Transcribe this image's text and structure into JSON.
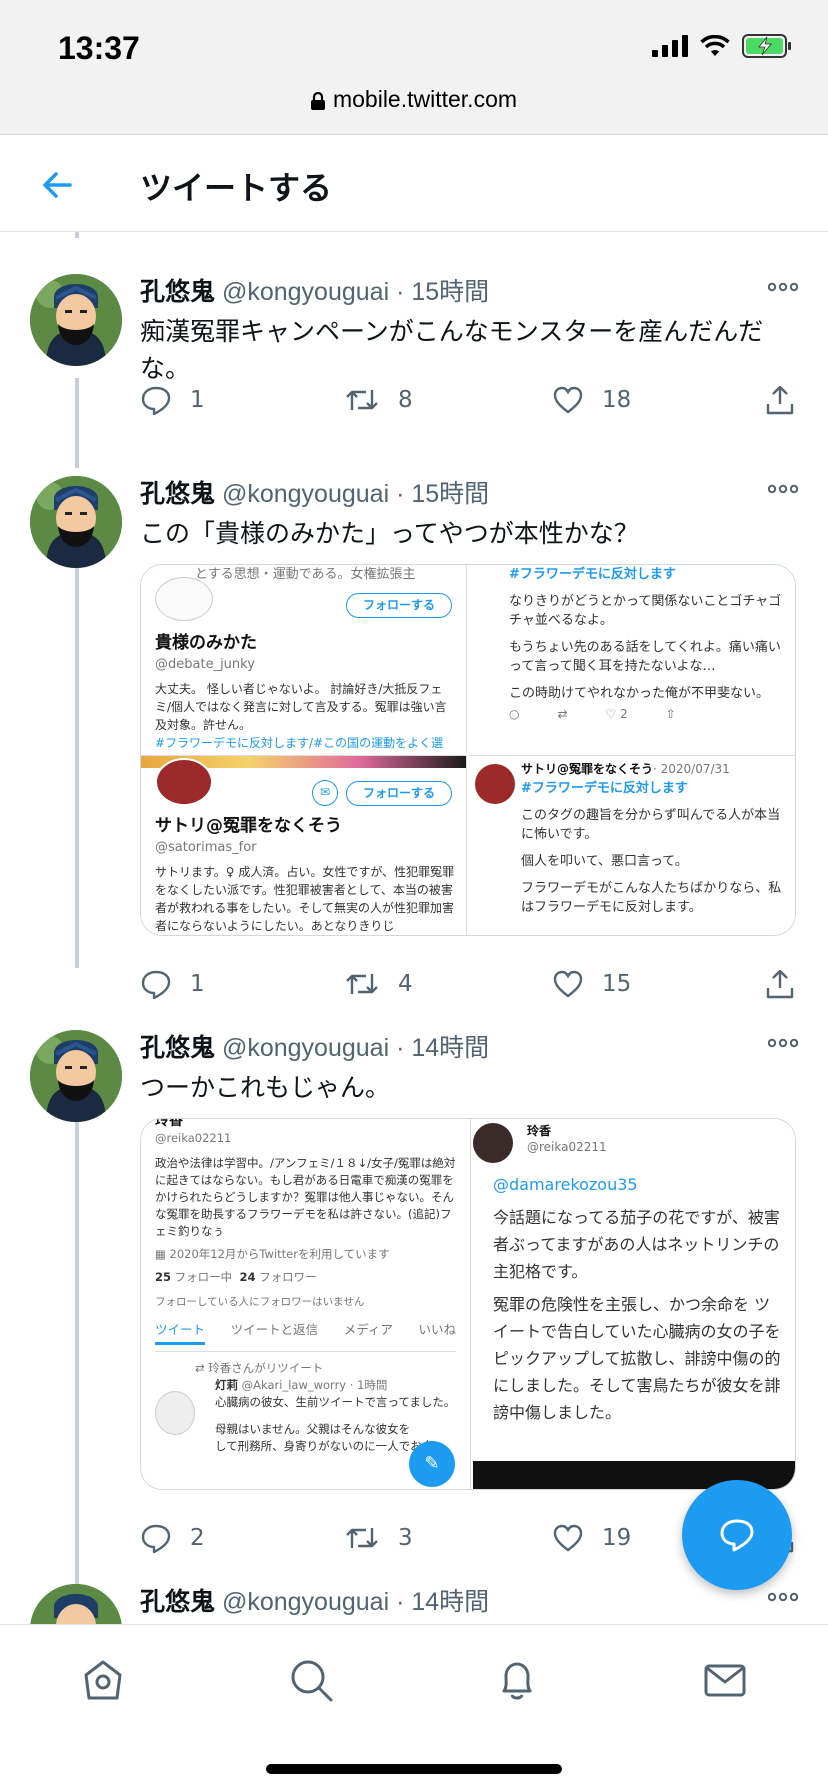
{
  "status_bar": {
    "time": "13:37",
    "url": "mobile.twitter.com"
  },
  "header": {
    "title": "ツイートする"
  },
  "tweets": [
    {
      "name": "孔悠鬼",
      "handle": "@kongyouguai",
      "time": "15時間",
      "text": "痴漢冤罪キャンペーンがこんなモンスターを産んだんだな。",
      "replies": "1",
      "retweets": "8",
      "likes": "18"
    },
    {
      "name": "孔悠鬼",
      "handle": "@kongyouguai",
      "time": "15時間",
      "text": "この「貴様のみかた」ってやつが本性かな？",
      "replies": "1",
      "retweets": "4",
      "likes": "15",
      "media": {
        "p1_top": "とする思想・運動である。女権拡張主",
        "p1_follow": "フォローする",
        "p1_name": "貴様のみかた",
        "p1_handle": "@debate_junky",
        "p1_bio": "大丈夫。 怪しい者じゃないよ。 討論好き/大抵反フェミ/個人ではなく発言に対して言及する。冤罪は強い言及対象。許せん。",
        "p1_bio_tag": "#フラワーデモに反対します/#この国の運動をよく選ぶ 発言を見るからフェミもフェ",
        "p2_tag": "#フラワーデモに反対します",
        "p2_l1": "なりきりがどうとかって関係ないことゴチャゴチャ並べるなよ。",
        "p2_l2": "もうちょい先のある話をしてくれよ。痛い痛いって言って聞く耳を持たないよな…",
        "p2_l3": "この時助けてやれなかった俺が不甲斐ない。",
        "p2_likes": "2",
        "p3_follow": "フォローする",
        "p3_name": "サトリ@冤罪をなくそう",
        "p3_handle": "@satorimas_for",
        "p3_bio": "サトリます。♀ 成人済。占い。女性ですが、性犯罪冤罪をなくしたい派です。性犯罪被害者として、本当の被害者が救われる事をしたい。そして無実の人が性犯罪加害者にならないようにしたい。あとなりきりじ",
        "p4_name": "サトリ@冤罪をなくそう",
        "p4_date": "· 2020/07/31",
        "p4_tag": "#フラワーデモに反対します",
        "p4_l1": "このタグの趣旨を分からず叫んでる人が本当に怖いです。",
        "p4_l2": "個人を叩いて、悪口言って。",
        "p4_l3": "フラワーデモがこんな人たちばかりなら、私はフラワーデモに反対します。"
      }
    },
    {
      "name": "孔悠鬼",
      "handle": "@kongyouguai",
      "time": "14時間",
      "text": "つーかこれもじゃん。",
      "replies": "2",
      "retweets": "3",
      "likes": "19",
      "media": {
        "l_top": "玲香",
        "l_handle": "@reika02211",
        "l_bio": "政治や法律は学習中。/アンフェミ/１８↓/女子/冤罪は絶対に起きてはならない。もし君がある日電車で痴漢の冤罪をかけられたらどうしますか？冤罪は他人事じゃない。そんな冤罪を助長するフラワーデモを私は許さない。(追記)フェミ釣りなぅ",
        "l_joined": "2020年12月からTwitterを利用しています",
        "l_following_n": "25",
        "l_following": "フォロー中",
        "l_followers_n": "24",
        "l_followers": "フォロワー",
        "l_nofollow": "フォローしている人にフォロワーはいません",
        "tabs": [
          "ツイート",
          "ツイートと返信",
          "メディア",
          "いいね"
        ],
        "l_rt": "玲香さんがリツイート",
        "l_rt_name": "灯莉",
        "l_rt_handle": "@Akari_law_worry · 1時間",
        "l_rt_text": "心臓病の彼女、生前ツイートで言ってました。",
        "l_rt_text2": "母親はいません。父親はそんな彼女を",
        "l_rt_text3": "して刑務所、身寄りがないのに一人でお金",
        "r_name": "玲香",
        "r_handle": "@reika02211",
        "r_mention": "@damarekozou35",
        "r_p1": "今話題になってる茄子の花ですが、被害者ぶってますがあの人はネットリンチの主犯格です。",
        "r_p2": "冤罪の危険性を主張し、かつ余命を ツイートで告白していた心臓病の女の子をピックアップして拡散し、誹謗中傷の的にしました。そして害鳥たちが彼女を誹謗中傷しました。"
      }
    },
    {
      "name": "孔悠鬼",
      "handle": "@kongyouguai",
      "time": "14時間"
    }
  ],
  "icons": [
    "back-arrow-icon",
    "lock-icon",
    "signal-icon",
    "wifi-icon",
    "battery-icon",
    "more-icon",
    "reply-icon",
    "retweet-icon",
    "like-icon",
    "share-icon",
    "home-icon",
    "search-icon",
    "bell-icon",
    "mail-icon",
    "compose-icon"
  ],
  "colors": {
    "accent": "#1d9bf0",
    "text": "#0f1419",
    "secondary": "#536471",
    "battery": "#4cd964"
  }
}
